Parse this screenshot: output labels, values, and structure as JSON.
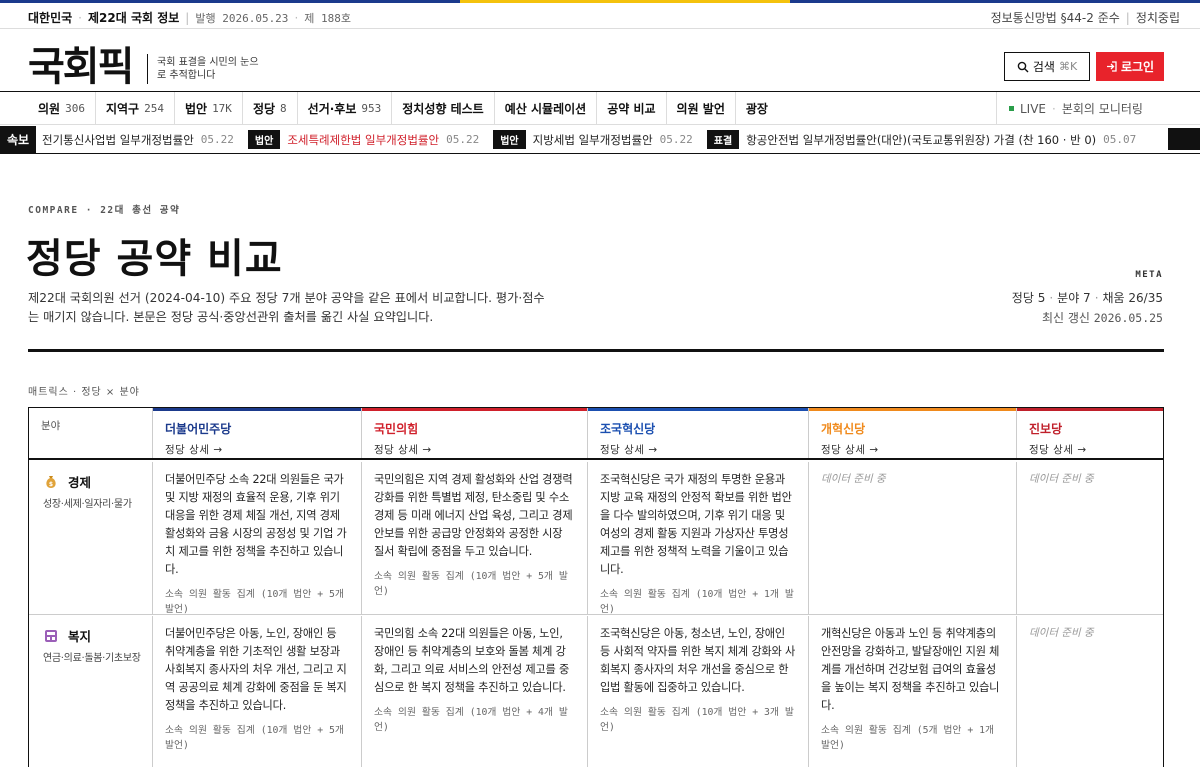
{
  "colors": {
    "dem": "#1b3a8c",
    "ppp": "#d0202b",
    "rebuild": "#1b4fb0",
    "reform": "#f08a1c",
    "progressive": "#c0202b",
    "brand_red": "#e8232b",
    "live": "#2a9d4a"
  },
  "topbar": {
    "country": "대한민국",
    "assembly": "제22대 국회 정보",
    "issued": "발행 2026.05.23",
    "issue_no": "제 188호",
    "compliance": "정보통신망법 §44-2 준수",
    "neutrality": "정치중립"
  },
  "header": {
    "logo": "국회픽",
    "tagline": "국회 표결을 시민의 눈으로 추적합니다",
    "search_label": "검색",
    "search_shortcut": "⌘K",
    "login_label": "로그인"
  },
  "nav": {
    "items": [
      {
        "label": "의원",
        "count": "306"
      },
      {
        "label": "지역구",
        "count": "254"
      },
      {
        "label": "법안",
        "count": "17K"
      },
      {
        "label": "정당",
        "count": "8"
      },
      {
        "label": "선거·후보",
        "count": "953"
      },
      {
        "label": "정치성향 테스트",
        "count": ""
      },
      {
        "label": "예산 시뮬레이션",
        "count": ""
      },
      {
        "label": "공약 비교",
        "count": ""
      },
      {
        "label": "의원 발언",
        "count": ""
      },
      {
        "label": "광장",
        "count": ""
      }
    ],
    "live_label": "LIVE",
    "live_text": "본회의 모니터링"
  },
  "ticker": {
    "label": "속보",
    "items": [
      {
        "badge": "",
        "title": "전기통신사업법 일부개정법률안",
        "date": "05.22",
        "highlight": false
      },
      {
        "badge": "법안",
        "title": "조세특례제한법 일부개정법률안",
        "date": "05.22",
        "highlight": true
      },
      {
        "badge": "법안",
        "title": "지방세법 일부개정법률안",
        "date": "05.22",
        "highlight": false
      },
      {
        "badge": "표결",
        "title": "항공안전법 일부개정법률안(대안)(국토교통위원장) 가결 (찬 160 · 반 0)",
        "date": "05.07",
        "highlight": false
      }
    ]
  },
  "page": {
    "kicker": "COMPARE · 22대 총선 공약",
    "title": "정당 공약 비교",
    "description": "제22대 국회의원 선거 (2024-04-10) 주요 정당 7개 분야 공약을 같은 표에서 비교합니다. 평가·점수는 매기지 않습니다. 본문은 정당 공식·중앙선관위 출처를 옮긴 사실 요약입니다.",
    "meta_label": "META",
    "meta_parties": "정당 5",
    "meta_fields": "분야 7",
    "meta_filled": "채움 26/35",
    "meta_updated_label": "최신 갱신",
    "meta_updated": "2026.05.25"
  },
  "matrix": {
    "label": "매트릭스 · 정당 × 분야",
    "field_header": "분야",
    "party_link": "정당 상세 →",
    "parties": [
      {
        "name": "더불어민주당",
        "color": "#1b3a8c"
      },
      {
        "name": "국민의힘",
        "color": "#d0202b"
      },
      {
        "name": "조국혁신당",
        "color": "#1b4fb0"
      },
      {
        "name": "개혁신당",
        "color": "#f08a1c"
      },
      {
        "name": "진보당",
        "color": "#c0202b"
      }
    ],
    "empty_text": "데이터 준비 중",
    "rows": [
      {
        "icon": "money-bag-icon",
        "label": "경제",
        "sub": "성장·세제·일자리·물가",
        "cells": [
          {
            "text": "더불어민주당 소속 22대 의원들은 국가 및 지방 재정의 효율적 운용, 기후 위기 대응을 위한 경제 체질 개선, 지역 경제 활성화와 금융 시장의 공정성 및 기업 가치 제고를 위한 정책을 추진하고 있습니다.",
            "note": "소속 의원 활동 집계 (10개 법안 + 5개 발언)"
          },
          {
            "text": "국민의힘은 지역 경제 활성화와 산업 경쟁력 강화를 위한 특별법 제정, 탄소중립 및 수소경제 등 미래 에너지 산업 육성, 그리고 경제 안보를 위한 공급망 안정화와 공정한 시장 질서 확립에 중점을 두고 있습니다.",
            "note": "소속 의원 활동 집계 (10개 법안 + 5개 발언)"
          },
          {
            "text": "조국혁신당은 국가 재정의 투명한 운용과 지방 교육 재정의 안정적 확보를 위한 법안을 다수 발의하였으며, 기후 위기 대응 및 여성의 경제 활동 지원과 가상자산 투명성 제고를 위한 정책적 노력을 기울이고 있습니다.",
            "note": "소속 의원 활동 집계 (10개 법안 + 1개 발언)"
          },
          {
            "text": "",
            "note": ""
          },
          {
            "text": "",
            "note": ""
          }
        ]
      },
      {
        "icon": "welfare-icon",
        "label": "복지",
        "sub": "연금·의료·돌봄·기초보장",
        "cells": [
          {
            "text": "더불어민주당은 아동, 노인, 장애인 등 취약계층을 위한 기초적인 생활 보장과 사회복지 종사자의 처우 개선, 그리고 지역 공공의료 체계 강화에 중점을 둔 복지 정책을 추진하고 있습니다.",
            "note": "소속 의원 활동 집계 (10개 법안 + 5개 발언)"
          },
          {
            "text": "국민의힘 소속 22대 의원들은 아동, 노인, 장애인 등 취약계층의 보호와 돌봄 체계 강화, 그리고 의료 서비스의 안전성 제고를 중심으로 한 복지 정책을 추진하고 있습니다.",
            "note": "소속 의원 활동 집계 (10개 법안 + 4개 발언)"
          },
          {
            "text": "조국혁신당은 아동, 청소년, 노인, 장애인 등 사회적 약자를 위한 복지 체계 강화와 사회복지 종사자의 처우 개선을 중심으로 한 입법 활동에 집중하고 있습니다.",
            "note": "소속 의원 활동 집계 (10개 법안 + 3개 발언)"
          },
          {
            "text": "개혁신당은 아동과 노인 등 취약계층의 안전망을 강화하고, 발달장애인 지원 체계를 개선하며 건강보험 급여의 효율성을 높이는 복지 정책을 추진하고 있습니다.",
            "note": "소속 의원 활동 집계 (5개 법안 + 1개 발언)"
          },
          {
            "text": "",
            "note": ""
          }
        ]
      }
    ]
  }
}
